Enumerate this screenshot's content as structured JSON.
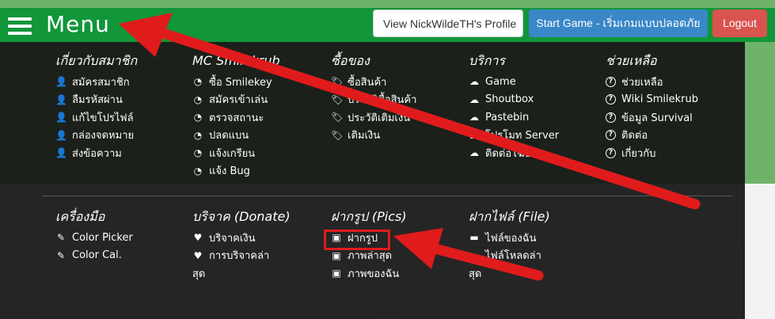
{
  "navbar": {
    "brand": "Menu",
    "profile_button": "View NickWildeTH's Profile",
    "start_button": "Start Game - เริ่มเกมแบบปลอดภัย",
    "logout_button": "Logout"
  },
  "menu": {
    "columns_top": [
      {
        "title": "เกี่ยวกับสมาชิก",
        "items": [
          {
            "icon": "user-icon",
            "label": "สมัครสมาชิก"
          },
          {
            "icon": "user-icon",
            "label": "ลืมรหัสผ่าน"
          },
          {
            "icon": "user-icon",
            "label": "แก้ไขโปรไฟล์"
          },
          {
            "icon": "user-icon",
            "label": "กล่องจดหมาย"
          },
          {
            "icon": "user-icon",
            "label": "ส่งข้อความ"
          }
        ]
      },
      {
        "title": "MC Smilekrub",
        "items": [
          {
            "icon": "pacman-icon",
            "label": "ซื้อ Smilekey"
          },
          {
            "icon": "pacman-icon",
            "label": "สมัครเข้าเล่น"
          },
          {
            "icon": "pacman-icon",
            "label": "ตรวจสถานะ"
          },
          {
            "icon": "pacman-icon",
            "label": "ปลดแบน"
          },
          {
            "icon": "pacman-icon",
            "label": "แจ้งเกรียน"
          },
          {
            "icon": "pacman-icon",
            "label": "แจ้ง Bug"
          }
        ]
      },
      {
        "title": "ซื้อของ",
        "items": [
          {
            "icon": "tags-icon",
            "label": "ซื้อสินค้า"
          },
          {
            "icon": "tags-icon",
            "label": "ประวัติซื้อสินค้า"
          },
          {
            "icon": "tags-icon",
            "label": "ประวัติเติมเงิน"
          },
          {
            "icon": "tags-icon",
            "label": "เติมเงิน"
          }
        ]
      },
      {
        "title": "บริการ",
        "items": [
          {
            "icon": "cloud-icon",
            "label": "Game"
          },
          {
            "icon": "cloud-icon",
            "label": "Shoutbox"
          },
          {
            "icon": "cloud-icon",
            "label": "Pastebin"
          },
          {
            "icon": "cloud-icon",
            "label": "โปรโมท Server"
          },
          {
            "icon": "cloud-icon",
            "label": "ติดต่อโฆษณา"
          }
        ]
      },
      {
        "title": "ช่วยเหลือ",
        "items": [
          {
            "icon": "question-circle-icon",
            "label": "ช่วยเหลือ"
          },
          {
            "icon": "question-circle-icon",
            "label": "Wiki Smilekrub"
          },
          {
            "icon": "question-circle-icon",
            "label": "ข้อมูล Survival"
          },
          {
            "icon": "question-circle-icon",
            "label": "ติดต่อ"
          },
          {
            "icon": "question-circle-icon",
            "label": "เกี่ยวกับ"
          }
        ]
      }
    ],
    "columns_bottom": [
      {
        "title": "เครื่องมือ",
        "items": [
          {
            "icon": "eyedropper-icon",
            "label": "Color Picker"
          },
          {
            "icon": "eyedropper-icon",
            "label": "Color Cal."
          }
        ]
      },
      {
        "title": "บริจาค (Donate)",
        "items": [
          {
            "icon": "heart-icon",
            "label": "บริจาคเงิน"
          },
          {
            "icon": "heart-icon",
            "label": "การบริจาคล่า",
            "cont": "สุด"
          }
        ]
      },
      {
        "title": "ฝากรูป (Pics)",
        "items": [
          {
            "icon": "picture-icon",
            "label": "ฝากรูป"
          },
          {
            "icon": "picture-icon",
            "label": "ภาพล่าสุด"
          },
          {
            "icon": "picture-icon",
            "label": "ภาพของฉัน"
          }
        ]
      },
      {
        "title": "ฝากไฟล์ (File)",
        "items": [
          {
            "icon": "folder-icon",
            "label": "ไฟล์ของฉัน"
          },
          {
            "icon": "folder-icon",
            "label": "ไฟล์โหลดล่า",
            "cont": "สุด"
          }
        ]
      }
    ]
  },
  "colors": {
    "navbar": "#11963a",
    "start_button": "#3a87c8",
    "logout_button": "#d9534f",
    "annotation": "#e01b1b"
  }
}
